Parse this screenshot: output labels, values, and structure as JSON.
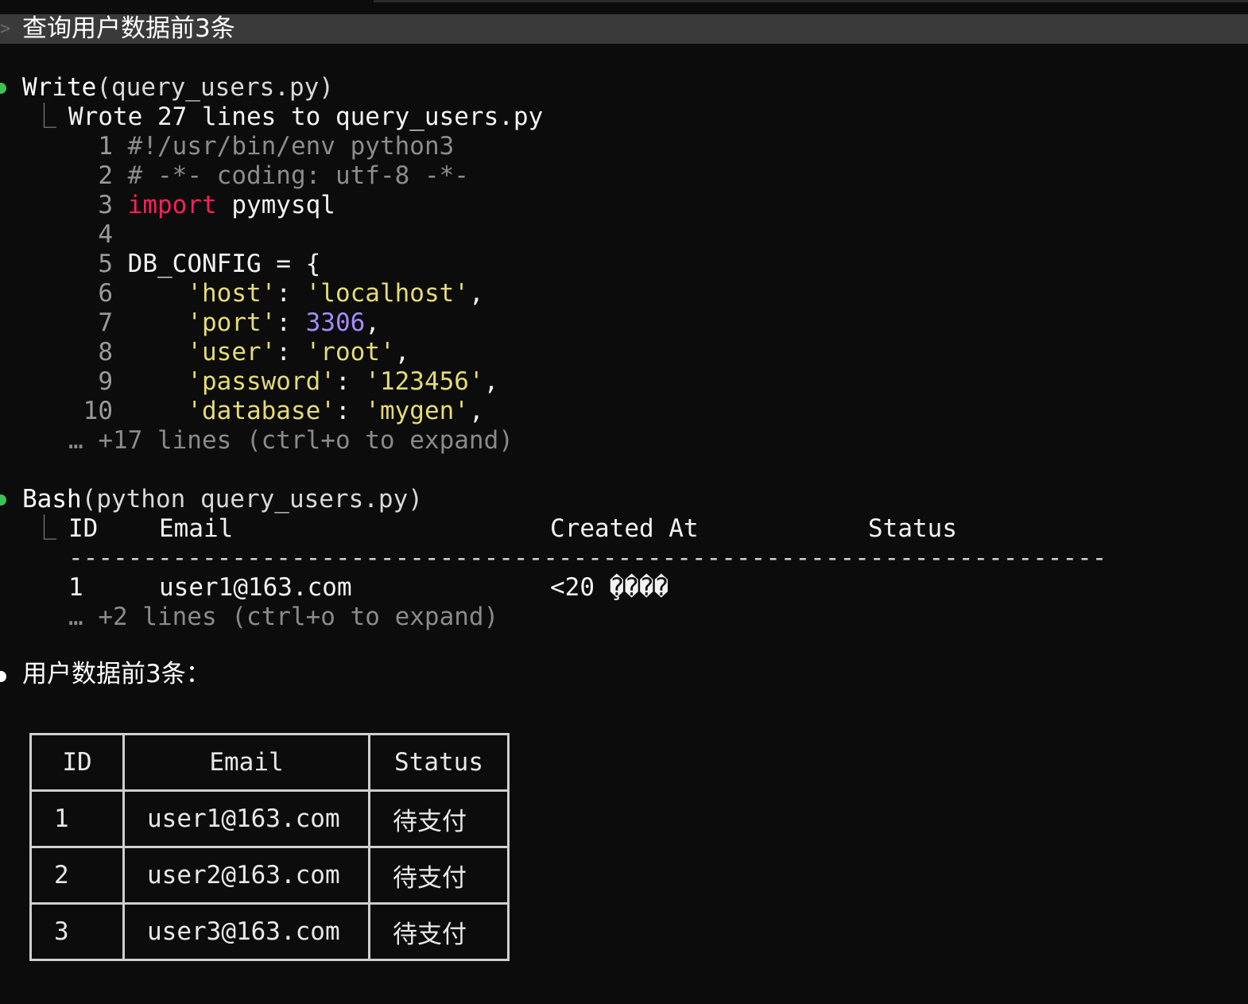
{
  "prompt": {
    "caret": ">",
    "text": "查询用户数据前3条"
  },
  "write_block": {
    "tool": "Write",
    "args": "(query_users.py)",
    "result": "Wrote 27 lines to query_users.py",
    "code_lines": [
      {
        "no": "1",
        "text": "#!/usr/bin/env python3"
      },
      {
        "no": "2",
        "text": "# -*- coding: utf-8 -*-"
      },
      {
        "no": "3",
        "kw": "import",
        "text": " pymysql"
      },
      {
        "no": "4",
        "text": ""
      },
      {
        "no": "5",
        "text": "DB_CONFIG = {"
      },
      {
        "no": "6",
        "key": "'host'",
        "sep": ": ",
        "val": "'localhost'",
        "end": ","
      },
      {
        "no": "7",
        "key": "'port'",
        "sep": ": ",
        "val": "3306",
        "end": ","
      },
      {
        "no": "8",
        "key": "'user'",
        "sep": ": ",
        "val": "'root'",
        "end": ","
      },
      {
        "no": "9",
        "key": "'password'",
        "sep": ": ",
        "val": "'123456'",
        "end": ","
      },
      {
        "no": "10",
        "key": "'database'",
        "sep": ": ",
        "val": "'mygen'",
        "end": ","
      }
    ],
    "more": "… +17 lines (ctrl+o to expand)"
  },
  "bash_block": {
    "tool": "Bash",
    "args": "(python query_users.py)",
    "headers": {
      "id": "ID",
      "email": "Email",
      "created": "Created At",
      "status": "Status"
    },
    "rule": "----------------------------------------------------------------------",
    "row": {
      "id": "1",
      "email": "user1@163.com",
      "created": "<20 ̧����"
    },
    "more": "… +2 lines (ctrl+o to expand)"
  },
  "summary": {
    "text": "用户数据前3条：",
    "table": {
      "headers": [
        "ID",
        "Email",
        "Status"
      ],
      "rows": [
        [
          "1",
          "user1@163.com",
          "待支付"
        ],
        [
          "2",
          "user2@163.com",
          "待支付"
        ],
        [
          "3",
          "user3@163.com",
          "待支付"
        ]
      ]
    }
  },
  "colors": {
    "background": "#0c0c0c",
    "prompt_bar": "#3a3a3a",
    "bullet_green": "#3fbf55",
    "keyword": "#ff1f5a",
    "string": "#e6db74",
    "number": "#a68bff",
    "comment": "#8c8c8c"
  }
}
